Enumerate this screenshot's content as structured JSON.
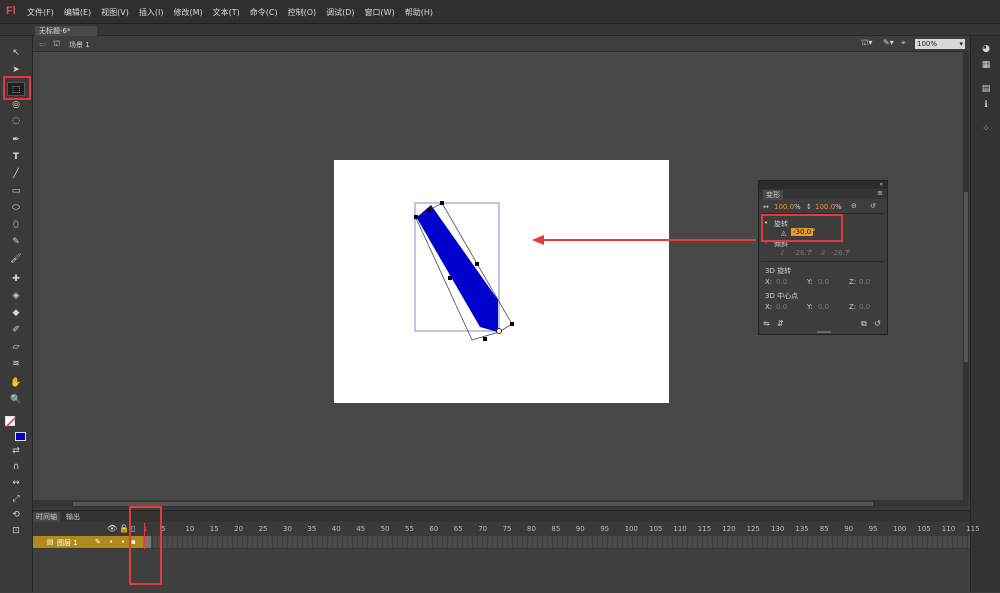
{
  "app": {
    "logo": "Fl"
  },
  "menu": [
    "文件(F)",
    "编辑(E)",
    "视图(V)",
    "插入(I)",
    "修改(M)",
    "文本(T)",
    "命令(C)",
    "控制(O)",
    "调试(D)",
    "窗口(W)",
    "帮助(H)"
  ],
  "document": {
    "tab": "无标题-6*",
    "scene": "场景 1",
    "zoom": "100%"
  },
  "transform_panel": {
    "title": "变形",
    "width_pct": "100.0",
    "height_pct": "100.0",
    "pct_unit": "%",
    "rotate_label": "旋转",
    "rotate_value": "-30.0",
    "degree": "°",
    "skew_label": "倾斜",
    "skew_h": "-26.7",
    "skew_v": "-26.7",
    "rot3d_label": "3D 旋转",
    "x_label": "X:",
    "y_label": "Y:",
    "z_label": "Z:",
    "rot3d_x": "0.0",
    "rot3d_y": "0.0",
    "rot3d_z": "0.0",
    "center3d_label": "3D 中心点",
    "center_x": "0.0",
    "center_y": "0.0",
    "center_z": "0.0"
  },
  "timeline": {
    "tab_timeline": "时间轴",
    "tab_output": "输出",
    "layer_name": "图层 1",
    "frame_numbers": [
      "1",
      "5",
      "10",
      "15",
      "20",
      "25",
      "30",
      "35",
      "40",
      "45",
      "50",
      "55",
      "60",
      "65",
      "70",
      "75",
      "80",
      "85",
      "90",
      "95",
      "100",
      "105",
      "110",
      "115",
      "120",
      "125",
      "130",
      "135",
      "85",
      "90",
      "95",
      "100",
      "105",
      "110",
      "115"
    ]
  },
  "colors": {
    "shape_fill": "#0000cc",
    "highlight": "#e23b3b",
    "accent": "#e09b2d",
    "stage": "#ffffff"
  }
}
